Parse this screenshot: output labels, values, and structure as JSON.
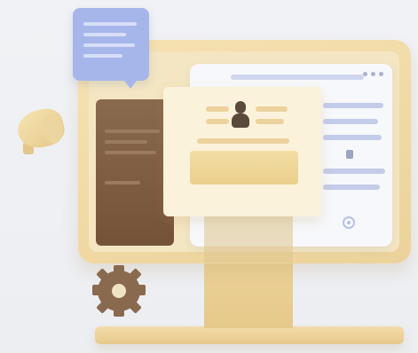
{
  "illustration": {
    "icons": [
      "chat-bubble-icon",
      "megaphone-icon",
      "gear-icon",
      "user-avatar-icon",
      "trash-icon",
      "badge-icon"
    ],
    "colors": {
      "monitor": "#ecd29a",
      "screen": "#f4e6c2",
      "dark_panel": "#7f5f44",
      "bubble": "#a6b6ea",
      "browser": "#f7f8fb",
      "card": "#fbf2dc",
      "background": "#eef0f3"
    }
  }
}
